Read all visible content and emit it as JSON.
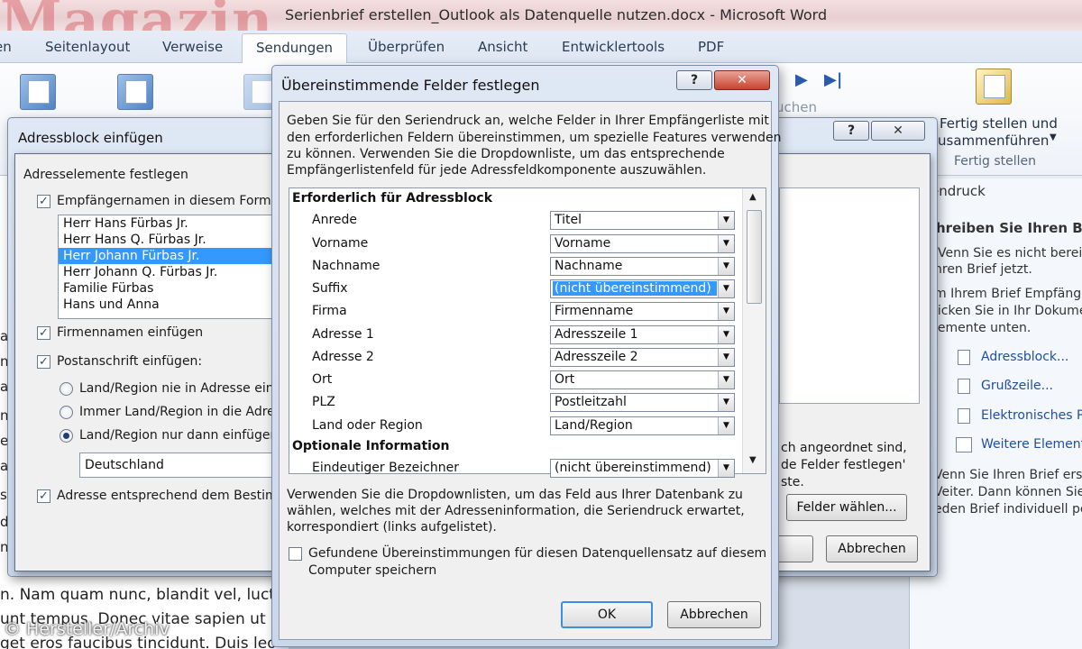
{
  "window": {
    "title": "Serienbrief erstellen_Outlook als Datenquelle nutzen.docx  -  Microsoft Word",
    "logo_text": "Magazin"
  },
  "ribbon_tabs": [
    {
      "label": "en"
    },
    {
      "label": "Seitenlayout"
    },
    {
      "label": "Verweise"
    },
    {
      "label": "Sendungen"
    },
    {
      "label": "Überprüfen"
    },
    {
      "label": "Ansicht"
    },
    {
      "label": "Entwicklertools"
    },
    {
      "label": "PDF"
    }
  ],
  "ribbon": {
    "vorschau_partial": "uchen",
    "fertig_button_line1": "Fertig stellen und",
    "fertig_button_line2": "usammenführen",
    "fertig_group": "Fertig stellen"
  },
  "document": {
    "lines": [
      "n. Nam quam nunc, blandit vel, luctu",
      "unt tempus. Donec vitae sapien ut li",
      "get eros faucibus tincidunt. Duis leo"
    ],
    "left_fragments": [
      "a",
      "n",
      "a",
      "n",
      "e",
      "a",
      "s",
      "d",
      "n"
    ],
    "watermark": "© Hersteller/Archiv"
  },
  "taskpane": {
    "header": "endruck",
    "heading": "hreiben Sie Ihren Bri",
    "para1": [
      "Venn Sie es nicht bereits",
      "hren Brief jetzt."
    ],
    "para2": [
      "m Ihrem Brief Empfänge",
      "licken Sie in Ihr Dokumen",
      "lemente unten."
    ],
    "links": [
      "Adressblock...",
      "Grußzeile...",
      "Elektronisches Po",
      "Weitere Elemente"
    ],
    "para3": [
      "Venn Sie Ihren Brief erst",
      "Veiter. Dann können Sie",
      "eden Brief individuell pe"
    ]
  },
  "adressblock_dialog": {
    "title": "Adressblock einfügen",
    "group_label": "Adresselemente festlegen",
    "chk_names": "Empfängernamen in diesem Format",
    "name_formats": [
      "Herr Hans Fürbas Jr.",
      "Herr Hans Q. Fürbas Jr.",
      "Herr Johann Fürbas Jr.",
      "Herr Johann Q. Fürbas Jr.",
      "Familie Fürbas",
      "Hans und Anna"
    ],
    "selected_format": "Herr Johann Fürbas Jr.",
    "chk_firm": "Firmennamen einfügen",
    "chk_post": "Postanschrift einfügen:",
    "radio1": "Land/Region nie in Adresse einf",
    "radio2": "Immer Land/Region in die Adres",
    "radio3": "Land/Region nur dann einfügen",
    "country_value": "Deutschland",
    "chk_format": "Adresse entsprechend dem Bestimm",
    "right_text1": "ch angeordnet sind,",
    "right_text2": "de Felder festlegen'",
    "right_text3": "ste.",
    "felder_button": "Felder wählen...",
    "cancel_button": "Abbrechen",
    "help_glyph": "?",
    "close_glyph": "✕"
  },
  "match_dialog": {
    "title": "Übereinstimmende Felder festlegen",
    "help_glyph": "?",
    "close_glyph": "✕",
    "intro": [
      "Geben Sie für den Seriendruck an, welche Felder in Ihrer Empfängerliste mit",
      "den erforderlichen Feldern übereinstimmen, um spezielle Features verwenden",
      "zu können. Verwenden Sie die Dropdownliste, um das entsprechende",
      "Empfängerlistenfeld für jede Adressfeldkomponente auszuwählen."
    ],
    "required_header": "Erforderlich für Adressblock",
    "fields": [
      {
        "label": "Anrede",
        "value": "Titel"
      },
      {
        "label": "Vorname",
        "value": "Vorname"
      },
      {
        "label": "Nachname",
        "value": "Nachname"
      },
      {
        "label": "Suffix",
        "value": "(nicht übereinstimmend)",
        "highlighted": true
      },
      {
        "label": "Firma",
        "value": "Firmenname"
      },
      {
        "label": "Adresse 1",
        "value": "Adresszeile 1"
      },
      {
        "label": "Adresse 2",
        "value": "Adresszeile 2"
      },
      {
        "label": "Ort",
        "value": "Ort"
      },
      {
        "label": "PLZ",
        "value": "Postleitzahl"
      },
      {
        "label": "Land oder Region",
        "value": "Land/Region"
      }
    ],
    "optional_header": "Optionale Information",
    "optional_fields": [
      {
        "label": "Eindeutiger Bezeichner",
        "value": "(nicht übereinstimmend)"
      }
    ],
    "footer": [
      "Verwenden Sie die Dropdownlisten, um das Feld aus Ihrer Datenbank zu",
      "wählen, welches mit der Adresseninformation, die Seriendruck erwartet,",
      "korrespondiert (links aufgelistet)."
    ],
    "save_checkbox": [
      "Gefundene Übereinstimmungen für diesen Datenquellensatz auf diesem",
      "Computer speichern"
    ],
    "ok_button": "OK",
    "cancel_button": "Abbrechen"
  },
  "colors": {
    "accent": "#3399ff",
    "link": "#1f4fa3",
    "title_bg": "#c9d7ea"
  }
}
